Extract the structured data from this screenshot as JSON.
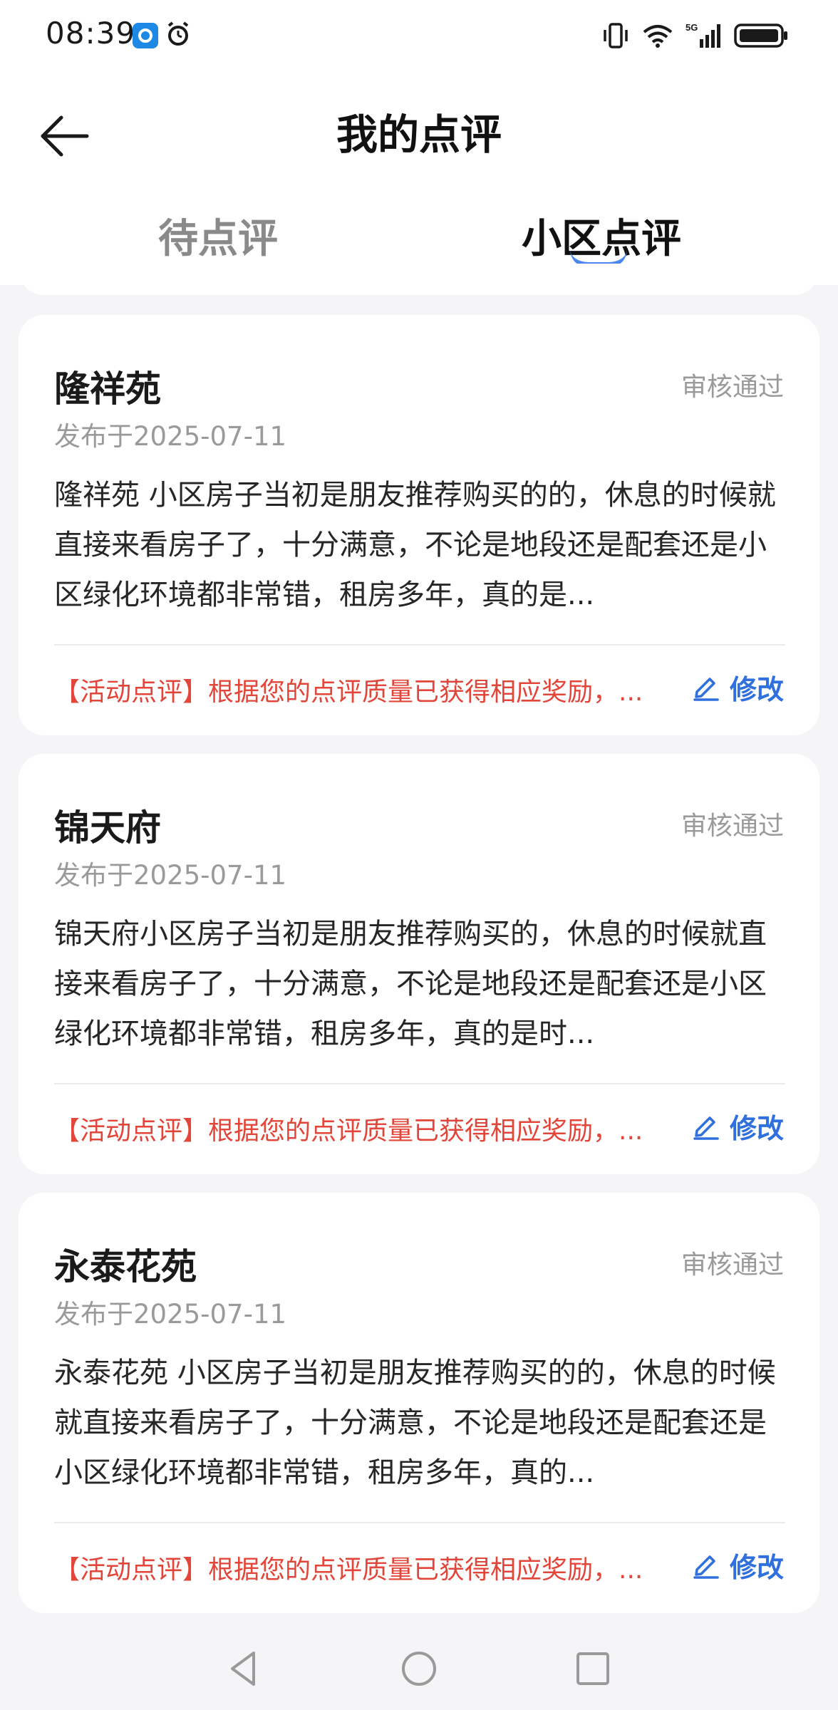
{
  "status_bar": {
    "time": "08:39",
    "icons": [
      "app-notification-icon",
      "alarm-icon",
      "vibrate-icon",
      "wifi-icon",
      "signal-5g-icon",
      "battery-icon"
    ],
    "network_label": "5G"
  },
  "header": {
    "title": "我的点评",
    "back_icon": "arrow-left-icon",
    "tabs": [
      {
        "label": "待点评",
        "active": false
      },
      {
        "label": "小区点评",
        "active": true
      }
    ]
  },
  "colors": {
    "accent": "#2f6fde",
    "activity_red": "#e2463a",
    "muted_text": "#9a9a9a",
    "background": "#f5f5f7"
  },
  "reviews": [
    {
      "community": "隆祥苑",
      "status": "审核通过",
      "date": "发布于2025-07-11",
      "text": "隆祥苑 小区房子当初是朋友推荐购买的的，休息的时候就直接来看房子了，十分满意，不论是地段还是配套还是小区绿化环境都非常错，租房多年，真的是...",
      "activity": "【活动点评】根据您的点评质量已获得相应奖励，...",
      "edit_label": "修改"
    },
    {
      "community": "锦天府",
      "status": "审核通过",
      "date": "发布于2025-07-11",
      "text": "锦天府小区房子当初是朋友推荐购买的，休息的时候就直接来看房子了，十分满意，不论是地段还是配套还是小区绿化环境都非常错，租房多年，真的是时...",
      "activity": "【活动点评】根据您的点评质量已获得相应奖励，...",
      "edit_label": "修改"
    },
    {
      "community": "永泰花苑",
      "status": "审核通过",
      "date": "发布于2025-07-11",
      "text": "永泰花苑 小区房子当初是朋友推荐购买的的，休息的时候就直接来看房子了，十分满意，不论是地段还是配套还是小区绿化环境都非常错，租房多年，真的...",
      "activity": "【活动点评】根据您的点评质量已获得相应奖励，...",
      "edit_label": "修改"
    }
  ],
  "nav_bar": {
    "icons": [
      "nav-back-icon",
      "nav-home-icon",
      "nav-recent-apps-icon"
    ]
  }
}
